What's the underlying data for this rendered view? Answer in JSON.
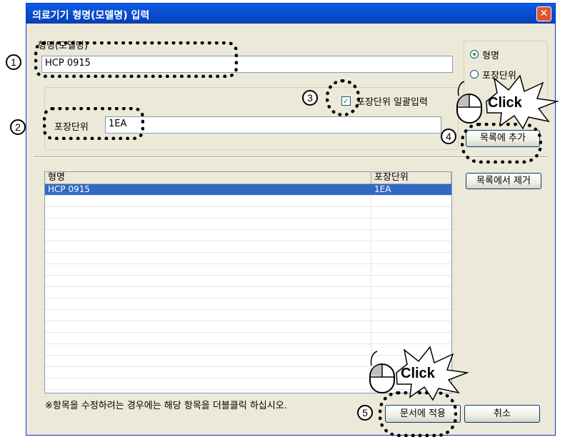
{
  "window": {
    "title": "의료기기 형명(모델명) 입력",
    "close_glyph": "✕"
  },
  "model": {
    "label": "형명(모델명)",
    "value": "HCP 0915"
  },
  "radio": {
    "opt1": "형명",
    "opt2": "포장단위",
    "selected": "형명"
  },
  "pack": {
    "label": "포장단위",
    "value": "1EA",
    "bulk_label": "포장단위 일괄입력",
    "bulk_checked": true
  },
  "buttons": {
    "add": "목록에 추가",
    "remove": "목록에서 제거",
    "apply": "문서에 적용",
    "cancel": "취소"
  },
  "table": {
    "columns": [
      "형명",
      "포장단위"
    ],
    "rows": [
      {
        "model": "HCP 0915",
        "pack": "1EA",
        "selected": true
      }
    ]
  },
  "hint": "※항목을 수정하려는 경우에는 해당 항목을 더블클릭 하십시오.",
  "annotations": {
    "n1": "1",
    "n2": "2",
    "n3": "3",
    "n4": "4",
    "n5": "5",
    "click": "Click"
  },
  "icons": [
    "mouse-icon",
    "checkmark-icon",
    "close-icon"
  ]
}
